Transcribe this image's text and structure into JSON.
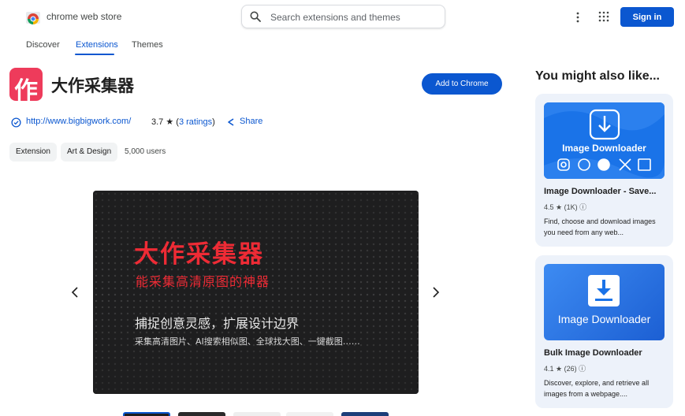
{
  "header": {
    "brand": "chrome web store",
    "search_placeholder": "Search extensions and themes",
    "signin_label": "Sign in"
  },
  "nav": {
    "items": [
      "Discover",
      "Extensions",
      "Themes"
    ],
    "active": "Extensions"
  },
  "extension": {
    "icon_char": "作",
    "title": "大作采集器",
    "add_label": "Add to Chrome",
    "website": "http://www.bigbigwork.com/",
    "rating_value": "3.7",
    "rating_star": "★",
    "rating_count_text": "3 ratings",
    "share_label": "Share",
    "chips": [
      "Extension",
      "Art & Design"
    ],
    "users": "5,000 users"
  },
  "slide": {
    "title": "大作采集器",
    "subtitle": "能采集高清原图的神器",
    "line1": "捕捉创意灵感，扩展设计边界",
    "line2": "采集高清图片、AI搜索相似图、全球找大图、一键截图……"
  },
  "sidebar": {
    "title": "You might also like...",
    "cards": [
      {
        "image_text": "Image Downloader",
        "name": "Image Downloader - Save...",
        "rating": "4.5",
        "count": "(1K)",
        "desc": "Find, choose and download images you need from any web..."
      },
      {
        "image_text": "Image Downloader",
        "name": "Bulk Image Downloader",
        "rating": "4.1",
        "count": "(26)",
        "desc": "Discover, explore, and retrieve all images from a webpage...."
      }
    ]
  },
  "colors": {
    "accent": "#0b57d0",
    "icon_bg": "#ee3b5b",
    "slide_red": "#ee2b35"
  }
}
